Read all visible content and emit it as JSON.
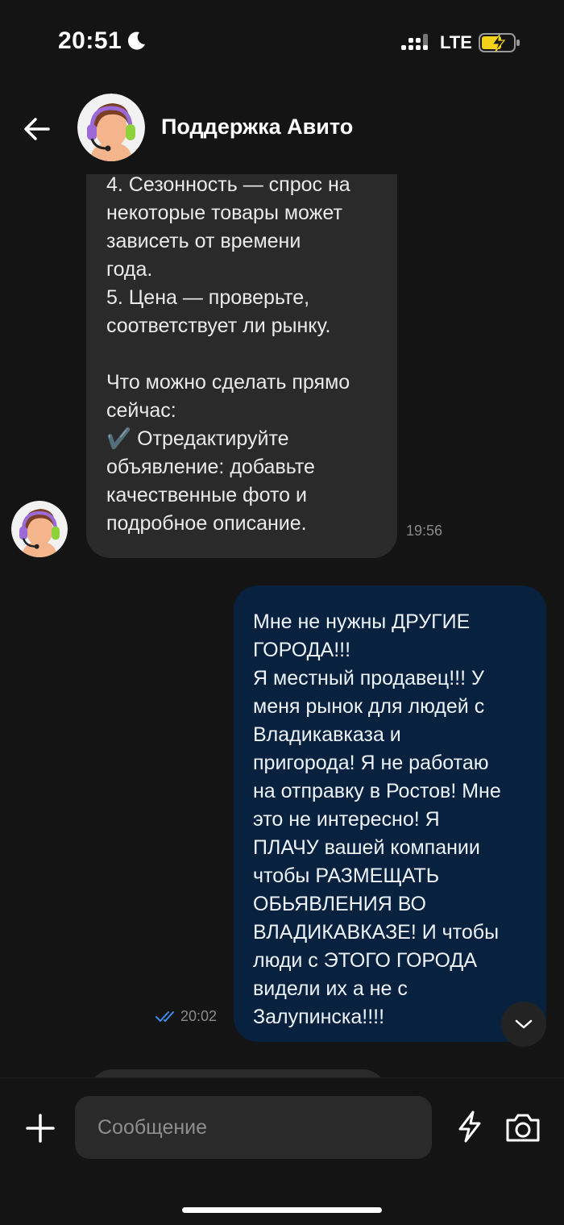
{
  "status_bar": {
    "time": "20:51",
    "network": "LTE",
    "icons": [
      "moon-icon",
      "signal-icon",
      "battery-charging-icon"
    ]
  },
  "header": {
    "title": "Поддержка Авито",
    "icons": [
      "back-arrow-icon",
      "support-agent-avatar"
    ]
  },
  "messages": [
    {
      "direction": "incoming",
      "text": "4. Сезонность — спрос на\nнекоторые товары может\nзависеть от времени\nгода.\n5. Цена — проверьте,\nсоответствует ли рынку.\n\nЧто можно сделать прямо\nсейчас:\n✔️ Отредактируйте\nобъявление: добавьте\nкачественные фото и\nподробное описание.",
      "time": "19:56"
    },
    {
      "direction": "outgoing",
      "text": "Мне не нужны ДРУГИЕ\nГОРОДА!!!\nЯ местный продавец!!! У\nменя рынок для людей с\nВладикавказа и\nпригорода! Я не работаю\nна отправку в Ростов! Мне\nэто не интересно! Я\nПЛАЧУ вашей компании\nчтобы РАЗМЕЩАТЬ\nОБЬЯВЛЕНИЯ ВО\nВЛАДИКАВКАЗЕ! И чтобы\nлюди с ЭТОГО ГОРОДА\nвидели их а не с\nЗалупинска!!!!",
      "time": "20:02",
      "status": "read"
    }
  ],
  "composer": {
    "placeholder": "Сообщение",
    "value": "",
    "icons": [
      "plus-icon",
      "lightning-icon",
      "camera-icon"
    ]
  },
  "colors": {
    "background": "#141414",
    "incoming_bubble": "#2a2a2a",
    "outgoing_bubble": "#07213f",
    "read_check": "#3d8cf0",
    "battery_fill": "#f5d21a"
  }
}
